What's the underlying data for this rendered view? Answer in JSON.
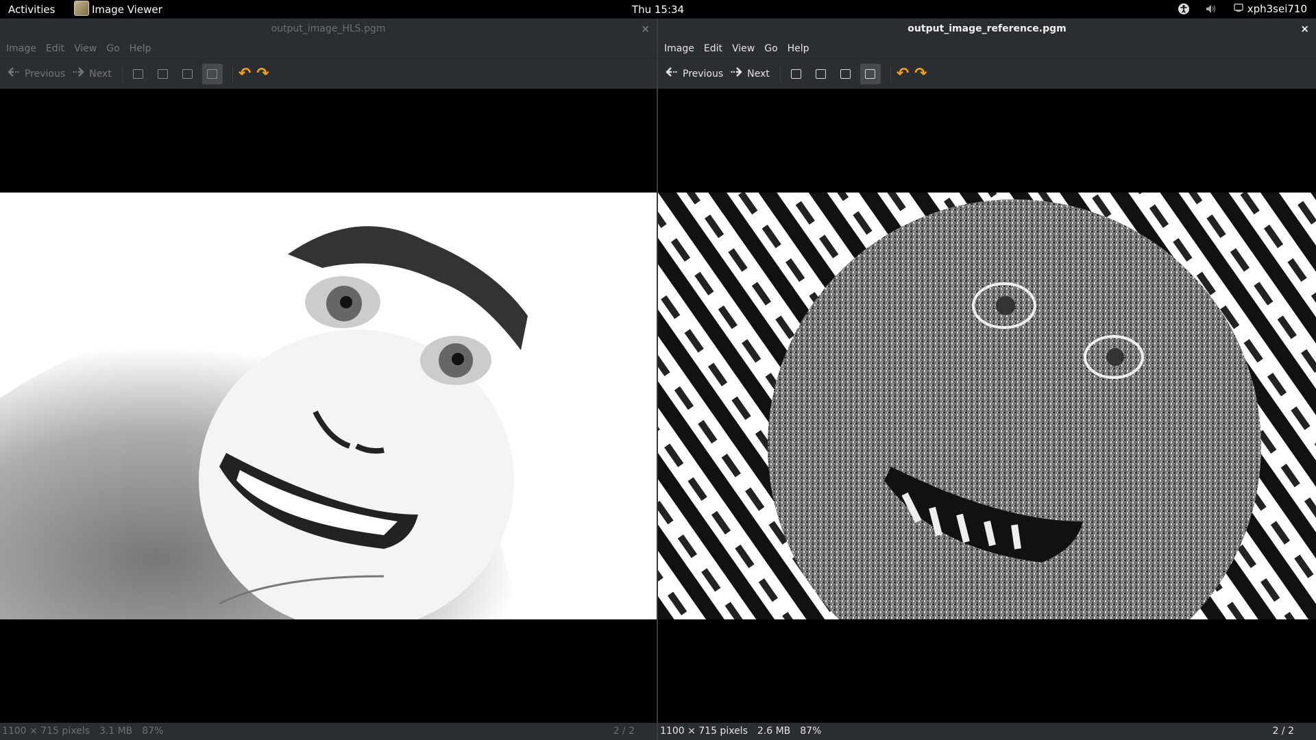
{
  "topbar": {
    "activities": "Activities",
    "app_name": "Image Viewer",
    "clock": "Thu 15:34",
    "user": "xph3sei710"
  },
  "windows": [
    {
      "title": "output_image_HLS.pgm",
      "close": "×",
      "menu": [
        "Image",
        "Edit",
        "View",
        "Go",
        "Help"
      ],
      "toolbar": {
        "previous": "Previous",
        "next": "Next"
      },
      "status": {
        "dimensions": "1100 × 715 pixels",
        "size": "3.1 MB",
        "zoom": "87%",
        "position": "2 / 2"
      },
      "focused": false
    },
    {
      "title": "output_image_reference.pgm",
      "close": "×",
      "menu": [
        "Image",
        "Edit",
        "View",
        "Go",
        "Help"
      ],
      "toolbar": {
        "previous": "Previous",
        "next": "Next"
      },
      "status": {
        "dimensions": "1100 × 715 pixels",
        "size": "2.6 MB",
        "zoom": "87%",
        "position": "2 / 2"
      },
      "focused": true
    }
  ],
  "colors": {
    "panel": "#2b2e30",
    "rotate_accent": "#f5a11a"
  },
  "icons": [
    "accessibility-icon",
    "volume-icon",
    "user-icon",
    "go-previous-icon",
    "go-next-icon",
    "rotate-left-icon",
    "rotate-right-icon"
  ]
}
